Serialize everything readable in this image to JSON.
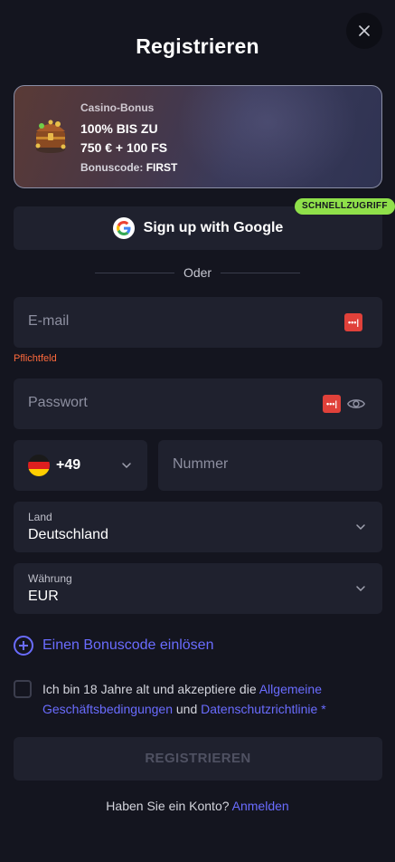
{
  "header": {
    "title": "Registrieren",
    "close_icon": "close-icon"
  },
  "bonus": {
    "label": "Casino-Bonus",
    "line1": "100% BIS ZU",
    "line2": "750 € + 100 FS",
    "code_label": "Bonuscode:",
    "code_value": "FIRST",
    "icon": "treasure-chest-icon"
  },
  "google": {
    "label": "Sign up with Google",
    "badge": "SCHNELLZUGRIFF",
    "icon": "google-icon"
  },
  "divider": {
    "text": "Oder"
  },
  "email": {
    "placeholder": "E-mail",
    "error": "Pflichtfeld"
  },
  "password": {
    "placeholder": "Passwort"
  },
  "phone": {
    "code": "+49",
    "placeholder": "Nummer",
    "flag": "germany-flag"
  },
  "country": {
    "label": "Land",
    "value": "Deutschland"
  },
  "currency": {
    "label": "Währung",
    "value": "EUR"
  },
  "bonus_code_link": "Einen Bonuscode einlösen",
  "terms": {
    "prefix": "Ich bin 18 Jahre alt und akzeptiere die ",
    "link1": "Allgemeine Geschäftsbedingungen",
    "middle": " und ",
    "link2": "Datenschutzrichtlinie",
    "suffix": " *"
  },
  "register_button": "REGISTRIEREN",
  "login": {
    "prompt": "Haben Sie ein Konto? ",
    "link": "Anmelden"
  },
  "colors": {
    "background": "#14151f",
    "field": "#1f212e",
    "accent": "#6a6cff",
    "error": "#ff6a3c",
    "badge": "#8fe04a"
  }
}
